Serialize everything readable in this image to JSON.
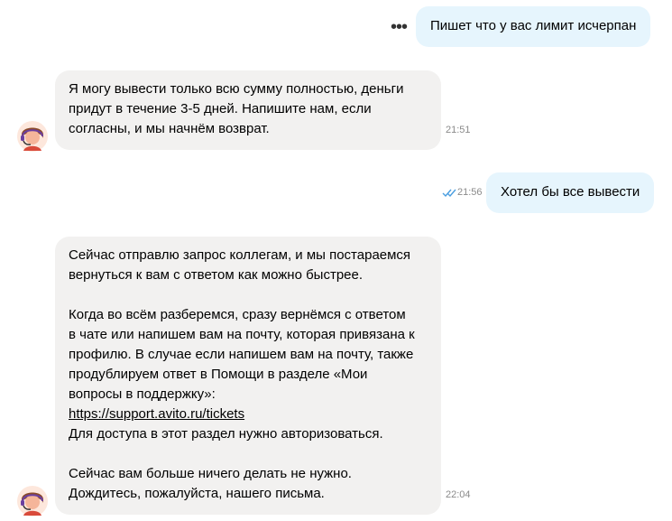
{
  "messages": [
    {
      "id": "m1",
      "side": "out",
      "text": "Пишет что у вас лимит исчерпан",
      "time": ""
    },
    {
      "id": "m2",
      "side": "in",
      "lines": [
        "Я могу вывести только всю сумму полностью, деньги",
        "придут в течение 3-5 дней. Напишите нам, если",
        "согласны, и мы начнём возврат."
      ],
      "time": "21:51"
    },
    {
      "id": "m3",
      "side": "out",
      "text": "Хотел бы все вывести",
      "time": "21:56",
      "status": "read"
    },
    {
      "id": "m4",
      "side": "in",
      "paragraph1": [
        "Сейчас отправлю запрос коллегам, и мы постараемся",
        "вернуться к вам с ответом как можно быстрее."
      ],
      "paragraph2": [
        "Когда во всём разберемся, сразу вернёмся с ответом",
        "в чате или напишем вам на почту, которая привязана к",
        "профилю. В случае если напишем вам на почту, также",
        "продублируем ответ в Помощи в разделе «Мои",
        "вопросы в поддержку»:"
      ],
      "link": "https://support.avito.ru/tickets",
      "after_link": "Для доступа в этот раздел нужно авторизоваться.",
      "paragraph3": [
        "Сейчас вам больше ничего делать не нужно.",
        "Дождитесь, пожалуйста, нашего письма."
      ],
      "time": "22:04"
    }
  ],
  "more_menu": {
    "icon": "more-dots-icon",
    "glyph": "•••"
  },
  "avatar": {
    "icon": "support-agent-avatar-icon"
  },
  "colors": {
    "outgoing_bubble": "#e6f5fd",
    "incoming_bubble": "#f2f1f0",
    "read_ticks": "#4a9ee0",
    "time": "#8a8a8a"
  }
}
